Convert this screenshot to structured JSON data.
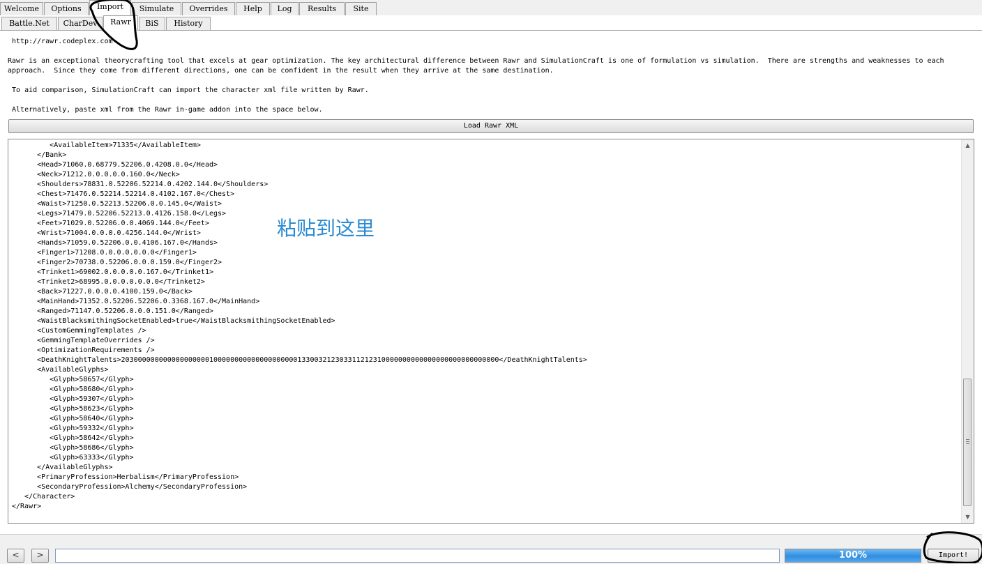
{
  "main_tabs": [
    {
      "label": "Welcome"
    },
    {
      "label": "Options"
    },
    {
      "label": "Import"
    },
    {
      "label": "Simulate"
    },
    {
      "label": "Overrides"
    },
    {
      "label": "Help"
    },
    {
      "label": "Log"
    },
    {
      "label": "Results"
    },
    {
      "label": "Site"
    }
  ],
  "active_main_tab": "Import",
  "sub_tabs": [
    {
      "label": "Battle.Net"
    },
    {
      "label": "CharDev"
    },
    {
      "label": "Rawr"
    },
    {
      "label": "BiS"
    },
    {
      "label": "History"
    }
  ],
  "active_sub_tab": "Rawr",
  "info": {
    "url": "http://rawr.codeplex.com",
    "para1_line1": "Rawr is an exceptional theorycrafting tool that excels at gear optimization. The key architectural difference between Rawr and SimulationCraft is one of formulation vs simulation.  There are strengths and weaknesses to each",
    "para1_line2": "approach.  Since they come from different directions, one can be confident in the result when they arrive at the same destination.",
    "para2": " To aid comparison, SimulationCraft can import the character xml file written by Rawr.",
    "para3": " Alternatively, paste xml from the Rawr in-game addon into the space below."
  },
  "load_button_label": "Load Rawr XML",
  "xml_lines": [
    "         <AvailableItem>71335</AvailableItem>",
    "      </Bank>",
    "      <Head>71060.0.68779.52206.0.4208.0.0</Head>",
    "      <Neck>71212.0.0.0.0.0.160.0</Neck>",
    "      <Shoulders>78831.0.52206.52214.0.4202.144.0</Shoulders>",
    "      <Chest>71476.0.52214.52214.0.4102.167.0</Chest>",
    "      <Waist>71250.0.52213.52206.0.0.145.0</Waist>",
    "      <Legs>71479.0.52206.52213.0.4126.158.0</Legs>",
    "      <Feet>71029.0.52206.0.0.4069.144.0</Feet>",
    "      <Wrist>71004.0.0.0.0.4256.144.0</Wrist>",
    "      <Hands>71059.0.52206.0.0.4106.167.0</Hands>",
    "      <Finger1>71208.0.0.0.0.0.0.0</Finger1>",
    "      <Finger2>70738.0.52206.0.0.0.159.0</Finger2>",
    "      <Trinket1>69002.0.0.0.0.0.167.0</Trinket1>",
    "      <Trinket2>68995.0.0.0.0.0.0.0</Trinket2>",
    "      <Back>71227.0.0.0.0.4100.159.0</Back>",
    "      <MainHand>71352.0.52206.52206.0.3368.167.0</MainHand>",
    "      <Ranged>71147.0.52206.0.0.0.151.0</Ranged>",
    "      <WaistBlacksmithingSocketEnabled>true</WaistBlacksmithingSocketEnabled>",
    "      <CustomGemmingTemplates />",
    "      <GemmingTemplateOverrides />",
    "      <OptimizationRequirements />",
    "      <DeathKnightTalents>203000000000000000000100000000000000000000133003212303311212310000000000000000000000000000</DeathKnightTalents>",
    "      <AvailableGlyphs>",
    "         <Glyph>58657</Glyph>",
    "         <Glyph>58680</Glyph>",
    "         <Glyph>59307</Glyph>",
    "         <Glyph>58623</Glyph>",
    "         <Glyph>58640</Glyph>",
    "         <Glyph>59332</Glyph>",
    "         <Glyph>58642</Glyph>",
    "         <Glyph>58686</Glyph>",
    "         <Glyph>63333</Glyph>",
    "      </AvailableGlyphs>",
    "      <PrimaryProfession>Herbalism</PrimaryProfession>",
    "      <SecondaryProfession>Alchemy</SecondaryProfession>",
    "   </Character>",
    "</Rawr>"
  ],
  "overlay_text": "粘贴到这里",
  "overlay_color": "#2a8ad2",
  "nav": {
    "back": "<",
    "forward": ">"
  },
  "command_value": "",
  "progress": {
    "label": "100%",
    "value": 1.0,
    "color": "#2f8de0"
  },
  "import_button_label": "Import!"
}
